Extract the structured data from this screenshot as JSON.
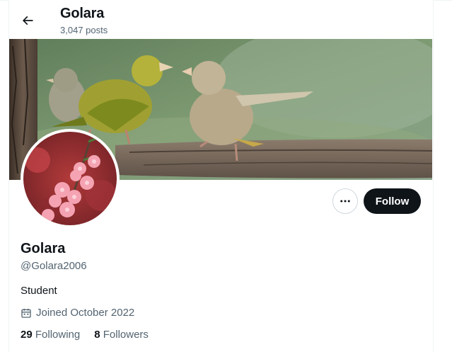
{
  "header": {
    "name": "Golara",
    "posts": "3,047 posts"
  },
  "profile": {
    "display_name": "Golara",
    "handle": "@Golara2006",
    "bio": "Student",
    "joined": "Joined October 2022",
    "following_count": "29",
    "following_label": "Following",
    "followers_count": "8",
    "followers_label": "Followers"
  },
  "actions": {
    "follow_label": "Follow",
    "more_icon": "more-dots-icon"
  },
  "icons": {
    "back": "arrow-left-icon",
    "calendar": "calendar-icon"
  },
  "colors": {
    "primary_text": "#0f1419",
    "secondary_text": "#536471",
    "follow_button": "#0f1419",
    "border": "#cfd9de"
  }
}
